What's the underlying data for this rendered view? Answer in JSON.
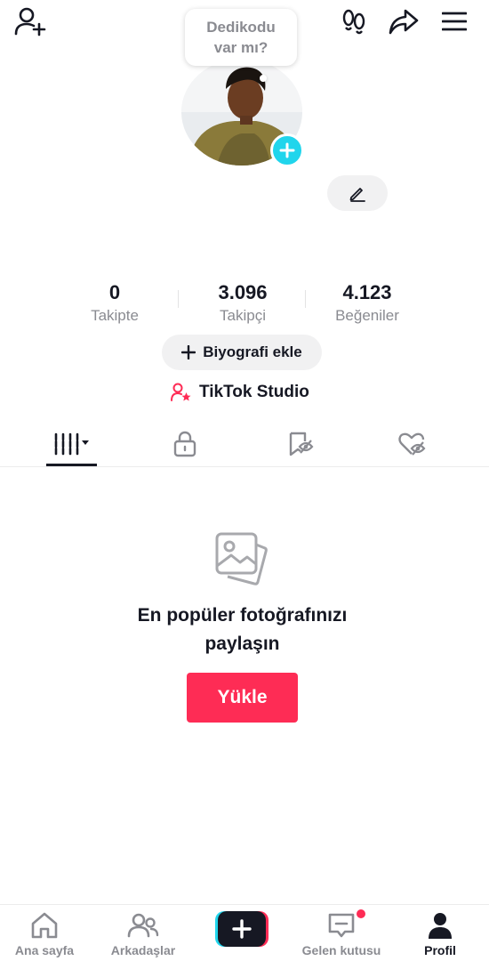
{
  "bubble": {
    "line1": "Dedikodu",
    "line2": "var mı?"
  },
  "stats": [
    {
      "value": "0",
      "label": "Takipte"
    },
    {
      "value": "3.096",
      "label": "Takipçi"
    },
    {
      "value": "4.123",
      "label": "Beğeniler"
    }
  ],
  "bio_button": {
    "label": "Biyografi ekle"
  },
  "studio": {
    "label": "TikTok Studio"
  },
  "empty_state": {
    "title_line1": "En popüler fotoğrafınızı",
    "title_line2": "paylaşın",
    "upload_label": "Yükle"
  },
  "nav": {
    "home": "Ana sayfa",
    "friends": "Arkadaşlar",
    "inbox": "Gelen kutusu",
    "profile": "Profil"
  },
  "icons": {
    "top": [
      "add-friend-icon",
      "footprints-icon",
      "share-icon",
      "menu-icon"
    ],
    "tabs": [
      "videos-grid-icon",
      "lock-icon",
      "repost-icon",
      "liked-icon"
    ]
  },
  "colors": {
    "accent": "#fe2c55",
    "cyan": "#20d5ec",
    "text": "#161823",
    "muted": "#8a8b91"
  }
}
